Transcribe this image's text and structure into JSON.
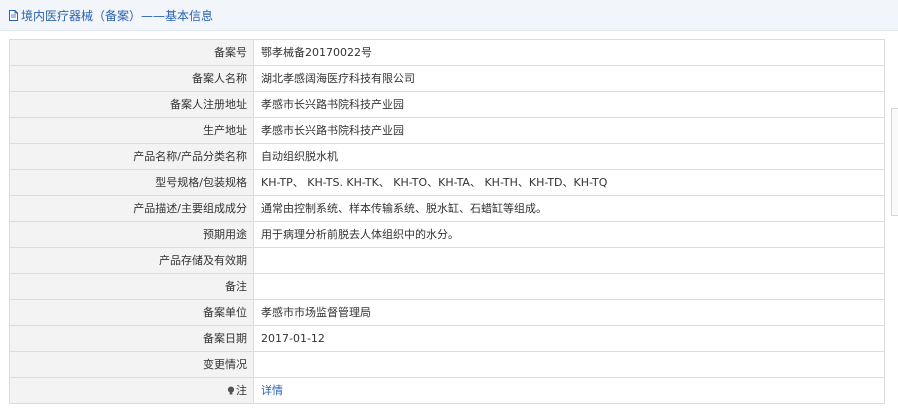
{
  "header": {
    "title": "境内医疗器械（备案）——基本信息",
    "icon": "document-icon"
  },
  "rows": [
    {
      "label": "备案号",
      "value": "鄂孝械备20170022号"
    },
    {
      "label": "备案人名称",
      "value": "湖北孝感阔海医疗科技有限公司"
    },
    {
      "label": "备案人注册地址",
      "value": "孝感市长兴路书院科技产业园"
    },
    {
      "label": "生产地址",
      "value": "孝感市长兴路书院科技产业园"
    },
    {
      "label": "产品名称/产品分类名称",
      "value": "自动组织脱水机"
    },
    {
      "label": "型号规格/包装规格",
      "value": "KH-TP、 KH-TS. KH-TK、 KH-TO、KH-TA、 KH-TH、KH-TD、KH-TQ"
    },
    {
      "label": "产品描述/主要组成成分",
      "value": "通常由控制系统、样本传输系统、脱水缸、石蜡缸等组成。"
    },
    {
      "label": "预期用途",
      "value": "用于病理分析前脱去人体组织中的水分。"
    },
    {
      "label": "产品存储及有效期",
      "value": ""
    },
    {
      "label": "备注",
      "value": ""
    },
    {
      "label": "备案单位",
      "value": "孝感市市场监督管理局"
    },
    {
      "label": "备案日期",
      "value": "2017-01-12"
    },
    {
      "label": "变更情况",
      "value": ""
    }
  ],
  "note_row": {
    "label": "注",
    "icon": "bulb-icon",
    "link_text": "详情"
  },
  "colors": {
    "header_bg": "#f2f5f9",
    "header_text": "#2b63b0",
    "label_bg": "#f3f3f3",
    "border": "#dcdcdc",
    "link": "#2b63b0"
  }
}
